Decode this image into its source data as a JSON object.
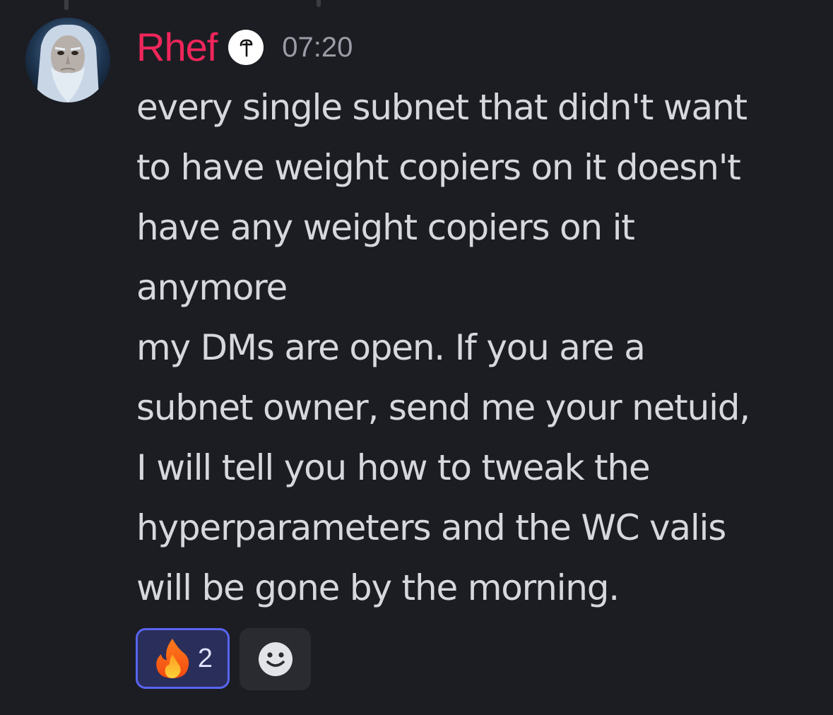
{
  "message": {
    "author": "Rhef",
    "timestamp": "07:20",
    "lines": [
      "every single subnet that didn't want",
      "to have weight copiers on it doesn't",
      "have any weight copiers on it",
      "anymore",
      "my DMs are open. If you are a",
      "subnet owner, send me your netuid,",
      "I will tell you how to tweak the",
      "hyperparameters and the WC valis",
      "will be gone by the morning."
    ],
    "author_color": "#f0265b",
    "badge_icon": "hook-badge-icon",
    "avatar_icon": "user-avatar"
  },
  "reactions": [
    {
      "emoji": "🔥",
      "icon": "fire-emoji-icon",
      "count": "2",
      "active": true
    }
  ],
  "add_reaction_icon": "smiley-add-reaction-icon"
}
